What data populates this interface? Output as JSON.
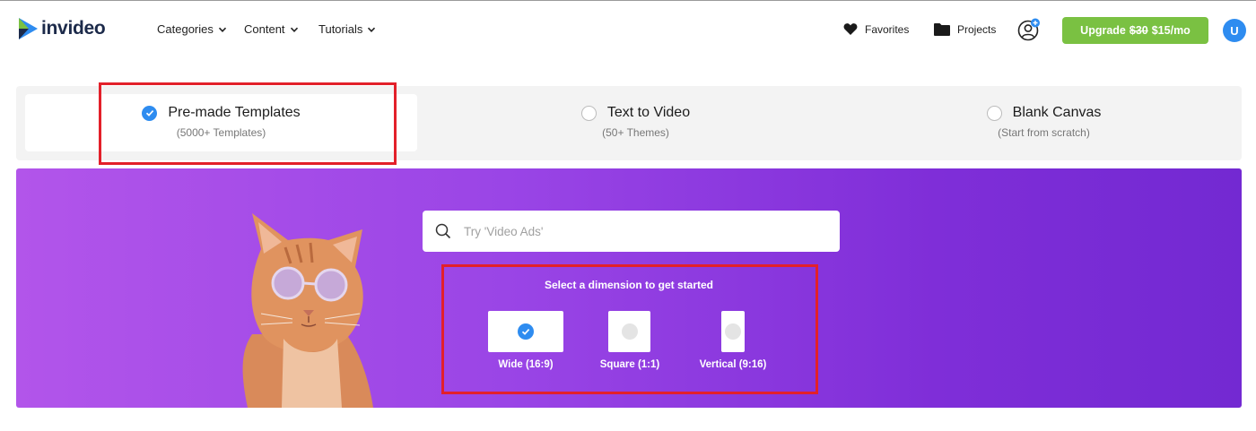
{
  "nav": {
    "logo_text": "invideo",
    "menu": [
      {
        "label": "Categories"
      },
      {
        "label": "Content"
      },
      {
        "label": "Tutorials"
      }
    ],
    "favorites_label": "Favorites",
    "projects_label": "Projects",
    "upgrade": {
      "prefix": "Upgrade",
      "old_price": "$30",
      "new_price": "$15/mo"
    },
    "avatar_initial": "U"
  },
  "tabs": [
    {
      "title": "Pre-made Templates",
      "subtitle": "(5000+ Templates)",
      "selected": true
    },
    {
      "title": "Text to Video",
      "subtitle": "(50+ Themes)",
      "selected": false
    },
    {
      "title": "Blank Canvas",
      "subtitle": "(Start from scratch)",
      "selected": false
    }
  ],
  "hero": {
    "search_placeholder": "Try 'Video Ads'",
    "dimension_title": "Select a dimension to get started",
    "dimensions": [
      {
        "label": "Wide (16:9)",
        "selected": true
      },
      {
        "label": "Square (1:1)",
        "selected": false
      },
      {
        "label": "Vertical (9:16)",
        "selected": false
      }
    ]
  },
  "colors": {
    "accent_blue": "#2e8cf0",
    "upgrade_green": "#7ac142",
    "hero_purple": "#9a45e6",
    "highlight_red": "#e3202a"
  }
}
